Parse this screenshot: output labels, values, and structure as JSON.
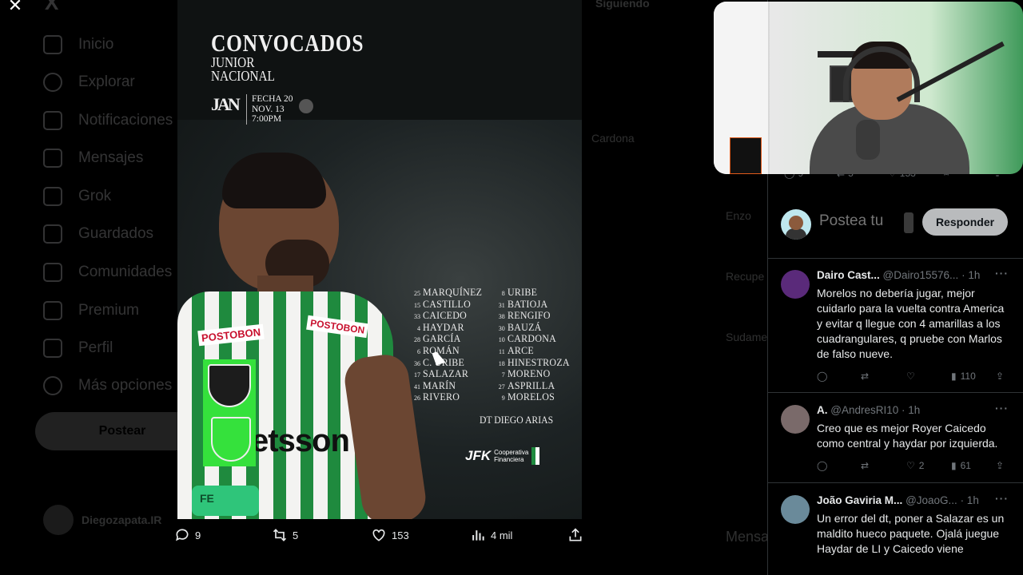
{
  "background_nav": {
    "logo": "X",
    "items": [
      "Inicio",
      "Explorar",
      "Notificaciones",
      "Mensajes",
      "Grok",
      "Guardados",
      "Comunidades",
      "Premium",
      "Perfil",
      "Más opciones"
    ],
    "post_button": "Postear",
    "profile_name": "Diegozapata.IR",
    "following_label": "Siguiendo"
  },
  "background_right": {
    "items": [
      "Cardona",
      "Enzo",
      "Recupe",
      "Sudame",
      "Mensa"
    ]
  },
  "close_label": "✕",
  "poster": {
    "title": "CONVOCADOS",
    "subtitle_1": "JUNIOR",
    "subtitle_2": "NACIONAL",
    "match_logo": "JAN",
    "match_line_1": "FECHA 20",
    "match_line_2": "NOV. 13",
    "match_line_3": "7:00PM",
    "sponsor_top": "POSTOBON",
    "sponsor_main": "etsson",
    "armband": "FE",
    "roster_left": [
      {
        "num": "25",
        "name": "MARQUÍNEZ"
      },
      {
        "num": "15",
        "name": "CASTILLO"
      },
      {
        "num": "33",
        "name": "CAICEDO"
      },
      {
        "num": "4",
        "name": "HAYDAR"
      },
      {
        "num": "28",
        "name": "GARCÍA"
      },
      {
        "num": "6",
        "name": "ROMÁN"
      },
      {
        "num": "36",
        "name": "C. URIBE"
      },
      {
        "num": "17",
        "name": "SALAZAR"
      },
      {
        "num": "41",
        "name": "MARÍN"
      },
      {
        "num": "26",
        "name": "RIVERO"
      }
    ],
    "roster_right": [
      {
        "num": "8",
        "name": "URIBE"
      },
      {
        "num": "31",
        "name": "BATIOJA"
      },
      {
        "num": "38",
        "name": "RENGIFO"
      },
      {
        "num": "30",
        "name": "BAUZÁ"
      },
      {
        "num": "10",
        "name": "CARDONA"
      },
      {
        "num": "11",
        "name": "ARCE"
      },
      {
        "num": "18",
        "name": "HINESTROZA"
      },
      {
        "num": "7",
        "name": "MORENO"
      },
      {
        "num": "27",
        "name": "ASPRILLA"
      },
      {
        "num": "9",
        "name": "MORELOS"
      }
    ],
    "coach": "DT DIEGO ARIAS",
    "jfk_logo": "JFK",
    "jfk_sub_1": "Cooperativa",
    "jfk_sub_2": "Financiera"
  },
  "post_actions": {
    "replies": "9",
    "reposts": "5",
    "likes": "153",
    "views": "4 mil"
  },
  "panel": {
    "top_stats": {
      "replies": "9",
      "reposts": "5",
      "likes": "153"
    },
    "reply_placeholder": "Postea tu",
    "reply_button": "Responder",
    "tweets": [
      {
        "name": "Dairo Cast...",
        "handle": "@Dairo15576...",
        "time": "· 1h",
        "text": "Morelos no debería jugar, mejor cuidarlo para la vuelta contra America y evitar q llegue con 4 amarillas a los cuadrangulares, q pruebe con Marlos de falso nueve.",
        "replies": "",
        "reposts": "",
        "likes": "",
        "views": "110",
        "avatar_color": "#5a2a7a"
      },
      {
        "name": "A.",
        "handle": "@AndresRI10",
        "time": "· 1h",
        "text": "Creo que es mejor Royer Caicedo como central y haydar por izquierda.",
        "replies": "",
        "reposts": "",
        "likes": "2",
        "views": "61",
        "avatar_color": "#7a6a6a"
      },
      {
        "name": "João Gaviria M...",
        "handle": "@JoaoG...",
        "time": "· 1h",
        "text": "Un error del dt, poner a Salazar es un maldito hueco paquete. Ojalá juegue Haydar de LI y Caicedo viene",
        "replies": "",
        "reposts": "",
        "likes": "",
        "views": "",
        "avatar_color": "#6a8a9a"
      }
    ]
  }
}
